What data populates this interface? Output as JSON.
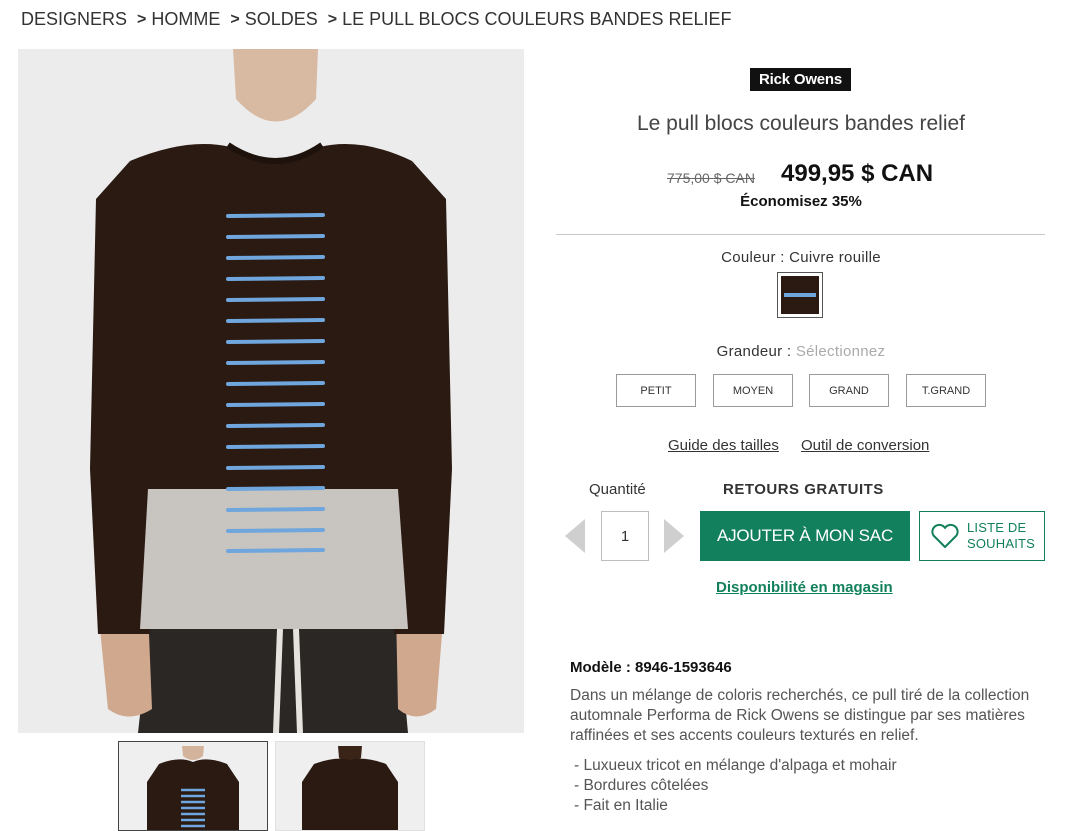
{
  "breadcrumb": [
    {
      "label": "DESIGNERS"
    },
    {
      "label": "HOMME"
    },
    {
      "label": "SOLDES"
    },
    {
      "label": "LE PULL BLOCS COULEURS BANDES RELIEF"
    }
  ],
  "breadcrumb_separator": ">",
  "product": {
    "brand": "Rick Owens",
    "title": "Le pull blocs couleurs bandes relief",
    "old_price": "775,00 $ CAN",
    "price": "499,95 $ CAN",
    "savings": "Économisez 35%",
    "color_label": "Couleur : Cuivre rouille",
    "size_label": "Grandeur : ",
    "size_placeholder": "Sélectionnez",
    "sizes": [
      "PETIT",
      "MOYEN",
      "GRAND",
      "T.GRAND"
    ],
    "size_guide_link": "Guide des tailles",
    "conversion_link": "Outil de conversion",
    "quantity_label": "Quantité",
    "quantity_value": "1",
    "free_returns": "RETOURS GRATUITS",
    "add_to_bag": "AJOUTER À MON SAC",
    "wishlist_line1": "LISTE DE",
    "wishlist_line2": "SOUHAITS",
    "store_availability": "Disponibilité en magasin",
    "model": "Modèle : 8946-1593646",
    "description": "Dans un mélange de coloris recherchés, ce pull tiré de la collection automnale Performa de Rick Owens se distingue par ses matières raffinées et ses accents couleurs texturés en relief.",
    "features": [
      "Luxueux tricot en mélange d'alpaga et mohair",
      "Bordures côtelées",
      "Fait en Italie"
    ]
  },
  "colors": {
    "accent_green": "#12805c",
    "sweater_brown": "#2a1a12",
    "stripe_blue": "#6fa6dd",
    "hem_grey": "#c8c4bf"
  },
  "icons": {
    "quantity_decrease": "chevron-left-icon",
    "quantity_increase": "chevron-right-icon",
    "wishlist": "heart-icon"
  }
}
